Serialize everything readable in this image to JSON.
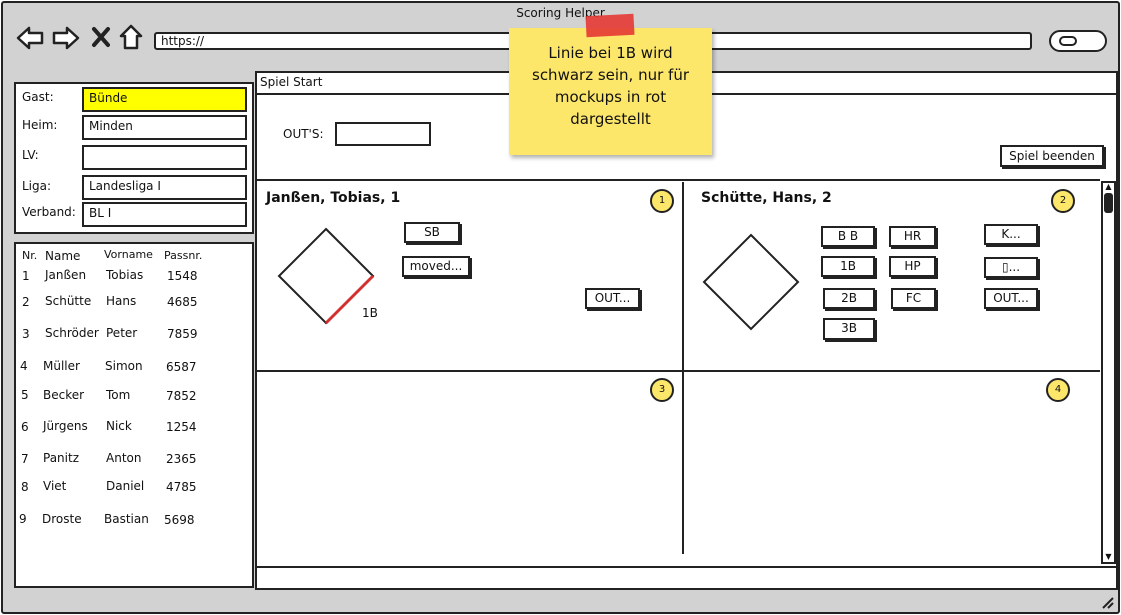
{
  "window": {
    "title": "Scoring Helper"
  },
  "browser": {
    "url": "https://"
  },
  "sticky_note": {
    "text": "Linie bei 1B wird schwarz sein, nur für mockups in rot dargestellt"
  },
  "game_info": {
    "gast_label": "Gast:",
    "gast_value": "Bünde",
    "heim_label": "Heim:",
    "heim_value": "Minden",
    "lv_label": "LV:",
    "lv_value": "",
    "liga_label": "Liga:",
    "liga_value": "Landesliga I",
    "verband_label": "Verband:",
    "verband_value": "BL I"
  },
  "roster": {
    "headers": [
      "Nr.",
      "Name",
      "Vorname",
      "Passnr."
    ],
    "rows": [
      [
        "1",
        "Janßen",
        "Tobias",
        "1548"
      ],
      [
        "2",
        "Schütte",
        "Hans",
        "4685"
      ],
      [
        "3",
        "Schröder",
        "Peter",
        "7859"
      ],
      [
        "4",
        "Müller",
        "Simon",
        "6587"
      ],
      [
        "5",
        "Becker",
        "Tom",
        "7852"
      ],
      [
        "6",
        "Jürgens",
        "Nick",
        "1254"
      ],
      [
        "7",
        "Panitz",
        "Anton",
        "2365"
      ],
      [
        "8",
        "Viet",
        "Daniel",
        "4785"
      ],
      [
        "9",
        "Droste",
        "Bastian",
        "5698"
      ]
    ]
  },
  "main": {
    "tab_label": "Spiel Start",
    "outs_label": "OUT'S:",
    "outs_value": "",
    "end_game_label": "Spiel beenden",
    "player1": {
      "name": "Janßen, Tobias, 1",
      "badge": "1",
      "base_label": "1B",
      "sb_label": "SB",
      "moved_label": "moved...",
      "out_label": "OUT..."
    },
    "player2": {
      "name": "Schütte, Hans, 2",
      "badge": "2",
      "bb_label": "B B",
      "hr_label": "HR",
      "k_label": "K...",
      "b1_label": "1B",
      "hp_label": "HP",
      "unknown_label": "▯...",
      "b2_label": "2B",
      "fc_label": "FC",
      "out_label": "OUT...",
      "b3_label": "3B"
    },
    "badge3": "3",
    "badge4": "4"
  }
}
